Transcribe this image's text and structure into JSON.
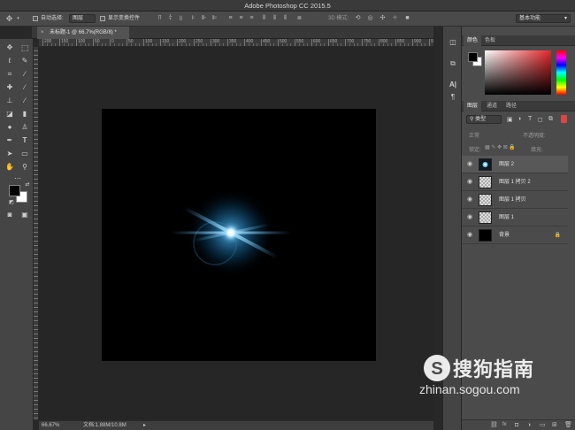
{
  "app": {
    "title": "Adobe Photoshop CC 2015.5"
  },
  "options_bar": {
    "auto_select_label": "自动选择:",
    "auto_select_value": "图层",
    "show_transform_label": "显示变换控件",
    "mode_3d_label": "3D 模式:",
    "workspace": "基本功能"
  },
  "document": {
    "tab_title": "未标题-1 @ 66.7%(RGB/8) *",
    "close": "×"
  },
  "ruler": {
    "top_ticks": [
      "200",
      "150",
      "100",
      "50",
      "0",
      "50",
      "100",
      "150",
      "200",
      "250",
      "300",
      "350",
      "400",
      "450",
      "500",
      "550",
      "600",
      "650",
      "700",
      "750",
      "800",
      "850",
      "900",
      "950",
      "1000",
      "1050",
      "1100"
    ]
  },
  "status": {
    "zoom": "66.67%",
    "doc_size": "文档:1.88M/10.8M"
  },
  "panels": {
    "color_tabs": [
      "颜色",
      "色板"
    ],
    "layer_tabs": [
      "图层",
      "通道",
      "路径"
    ],
    "filter_kind": "类型",
    "blend_mode": "正常",
    "opacity_label": "不透明度:",
    "lock_label": "锁定:",
    "fill_label": "填充:",
    "layers": [
      {
        "name": "图层 2",
        "thumb": "flare",
        "locked": false
      },
      {
        "name": "图层 1 拷贝 2",
        "thumb": "transparent",
        "locked": false
      },
      {
        "name": "图层 1 拷贝",
        "thumb": "transparent",
        "locked": false
      },
      {
        "name": "图层 1",
        "thumb": "transparent",
        "locked": false
      },
      {
        "name": "背景",
        "thumb": "black",
        "locked": true
      }
    ]
  },
  "watermark": {
    "brand": "搜狗指南",
    "url": "zhinan.sogou.com"
  },
  "colors": {
    "foreground": "#000000",
    "background": "#ffffff",
    "flare": "#3fb6ff",
    "accent": "#e5252a"
  },
  "icons": [
    "move-icon",
    "marquee-icon",
    "lasso-icon",
    "quick-select-icon",
    "crop-icon",
    "eyedropper-icon",
    "healing-icon",
    "brush-icon",
    "stamp-icon",
    "history-brush-icon",
    "eraser-icon",
    "gradient-icon",
    "blur-icon",
    "dodge-icon",
    "pen-icon",
    "type-icon",
    "path-select-icon",
    "shape-icon",
    "hand-icon",
    "zoom-icon",
    "eye-icon",
    "lock-icon"
  ]
}
